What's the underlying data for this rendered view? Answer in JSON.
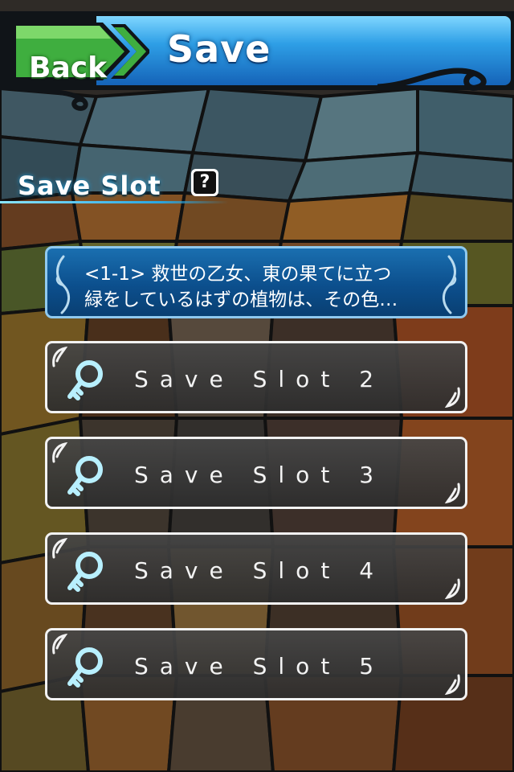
{
  "header": {
    "back_label": "Back",
    "title": "Save"
  },
  "section": {
    "title": "Save Slot",
    "help_symbol": "?"
  },
  "slots": [
    {
      "filled": true,
      "line1": "<1-1> 救世の乙女、東の果てに立つ",
      "line2": "緑をしているはずの植物は、その色…"
    },
    {
      "filled": false,
      "label": "Save Slot 2"
    },
    {
      "filled": false,
      "label": "Save Slot 3"
    },
    {
      "filled": false,
      "label": "Save Slot 4"
    },
    {
      "filled": false,
      "label": "Save Slot 5"
    }
  ],
  "icons": {
    "back": "back-arrow-icon",
    "help": "question-icon",
    "slot": "key-icon"
  },
  "colors": {
    "header_blue": "#2e9fe6",
    "back_green": "#3fa93f",
    "slot_border": "#f2f2f2",
    "filled_slot": "#0c4f8d"
  }
}
